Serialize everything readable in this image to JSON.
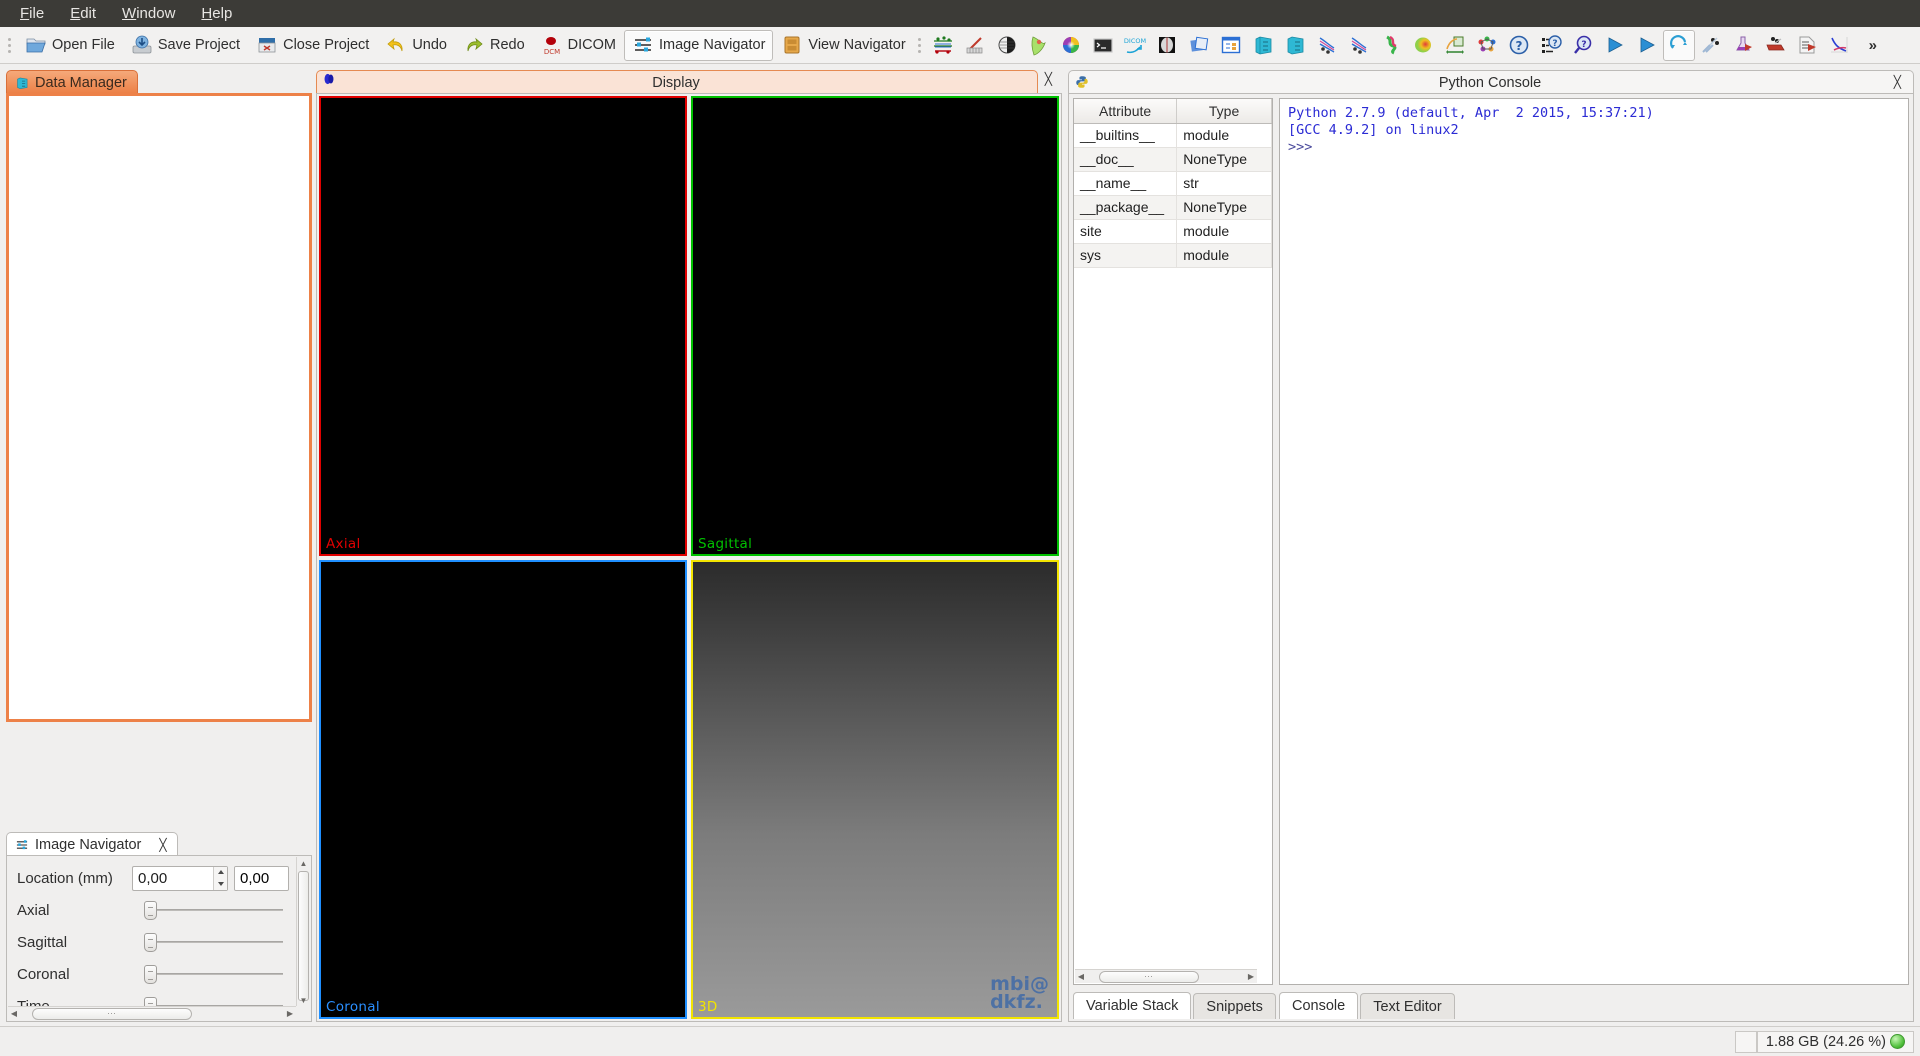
{
  "menubar": {
    "items": [
      {
        "label": "File",
        "mnemonic": "F"
      },
      {
        "label": "Edit",
        "mnemonic": "E"
      },
      {
        "label": "Window",
        "mnemonic": "W"
      },
      {
        "label": "Help",
        "mnemonic": "H"
      }
    ]
  },
  "toolbar": {
    "buttons": [
      {
        "label": "Open File",
        "icon": "open-folder-icon",
        "checked": false
      },
      {
        "label": "Save Project",
        "icon": "save-disk-icon",
        "checked": false
      },
      {
        "label": "Close Project",
        "icon": "close-project-icon",
        "checked": false
      },
      {
        "label": "Undo",
        "icon": "undo-arrow-icon",
        "checked": false
      },
      {
        "label": "Redo",
        "icon": "redo-arrow-icon",
        "checked": false
      },
      {
        "label": "DICOM",
        "icon": "dicom-icon",
        "checked": false
      },
      {
        "label": "Image Navigator",
        "icon": "image-navigator-icon",
        "checked": true
      },
      {
        "label": "View Navigator",
        "icon": "view-navigator-icon",
        "checked": false
      }
    ],
    "icon_buttons": [
      "point-set-interaction-icon",
      "measurement-icon",
      "segmentation-icon",
      "multilabel-segmentation-icon",
      "color-wheel-icon",
      "screenshot-icon",
      "dicom-export-icon",
      "image-cropper-icon",
      "registration-icon",
      "properties-icon",
      "data-manager-icon",
      "datastorage-icon",
      "diffusion-preprocessing-icon",
      "diffusion-quantification-icon",
      "fiber-tractography-icon",
      "perfusion-icon",
      "image-statistics-icon",
      "connectomics-icon",
      "help-icon",
      "help-contents-icon",
      "help-search-icon",
      "play-icon",
      "play-blue-icon",
      "refresh-icon",
      "simulation-icon",
      "flask-icon",
      "phantom-icon",
      "report-icon",
      "plot-icon"
    ],
    "overflow_label": "»"
  },
  "panels": {
    "data_manager": {
      "tab_label": "Data Manager",
      "tab_icon": "data-manager-icon",
      "active": true,
      "content": ""
    },
    "display": {
      "tab_label": "Display",
      "tab_icon": "display-icon",
      "close_icon": "close-icon",
      "render_windows": [
        {
          "name": "Axial",
          "label": "Axial",
          "color": "#e10000",
          "watermark": null
        },
        {
          "name": "Sagittal",
          "label": "Sagittal",
          "color": "#00c000",
          "watermark": null
        },
        {
          "name": "Coronal",
          "label": "Coronal",
          "color": "#2a8fff",
          "watermark": null
        },
        {
          "name": "3D",
          "label": "3D",
          "color": "#f2e400",
          "watermark": "mbi@\ndkfz."
        }
      ]
    },
    "image_navigator": {
      "tab_label": "Image Navigator",
      "tab_icon": "image-navigator-icon",
      "close_icon": "close-icon",
      "location_label": "Location (mm)",
      "location_value_1": "0,00",
      "location_value_2": "0,00",
      "sliders": [
        {
          "label": "Axial",
          "value": 0
        },
        {
          "label": "Sagittal",
          "value": 0
        },
        {
          "label": "Coronal",
          "value": 0
        },
        {
          "label": "Time",
          "value": 0
        }
      ]
    },
    "python_console": {
      "tab_label": "Python Console",
      "tab_icon": "python-icon",
      "close_icon": "close-icon",
      "variable_stack": {
        "columns": [
          "Attribute",
          "Type"
        ],
        "rows": [
          [
            "__builtins__",
            "module"
          ],
          [
            "__doc__",
            "NoneType"
          ],
          [
            "__name__",
            "str"
          ],
          [
            "__package__",
            "NoneType"
          ],
          [
            "site",
            "module"
          ],
          [
            "sys",
            "module"
          ]
        ]
      },
      "left_tabs": [
        {
          "label": "Variable Stack",
          "selected": true
        },
        {
          "label": "Snippets",
          "selected": false
        }
      ],
      "right_tabs": [
        {
          "label": "Console",
          "selected": true
        },
        {
          "label": "Text Editor",
          "selected": false
        }
      ],
      "console_lines": [
        "Python 2.7.9 (default, Apr  2 2015, 15:37:21)",
        "[GCC 4.9.2] on linux2",
        ">>>"
      ]
    }
  },
  "statusbar": {
    "memory_label": "1.88 GB (24.26 %)",
    "memory_led_color": "#4fbf3a"
  },
  "colors": {
    "accent_orange": "#ed8148",
    "menubar_bg": "#3c3b37",
    "chrome_bg": "#f0efee",
    "axial": "#e10000",
    "sagittal": "#00c000",
    "coronal": "#2a8fff",
    "threed": "#f2e400",
    "console_text": "#2b2bd4"
  }
}
